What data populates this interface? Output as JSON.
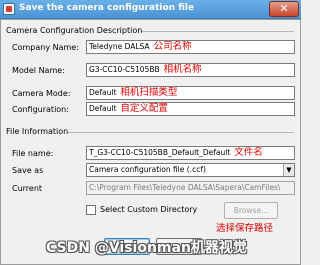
{
  "window": {
    "title": "Save the camera configuration file",
    "close_glyph": "✕"
  },
  "camera_section": {
    "title": "Camera Configuration Description",
    "company_label": "Company Name:",
    "company_value": "Teledyne DALSA",
    "company_note": "公司名称",
    "model_label": "Model Name:",
    "model_value": "G3-CC10-C5105BB",
    "model_note": "相机名称",
    "mode_label": "Camera Mode:",
    "mode_value": "Default",
    "mode_note": "相机扫描类型",
    "config_label": "Configuration:",
    "config_value": "Default",
    "config_note": "自定义配置"
  },
  "file_section": {
    "title": "File Information",
    "filename_label": "File name:",
    "filename_value": "T_G3-CC10-C5105BB_Default_Default",
    "filename_note": "文件名",
    "saveas_label": "Save as",
    "saveas_value": "Camera configuration file (.ccf)",
    "current_label": "Current",
    "current_value": "C:\\Program Files\\Teledyne DALSA\\Sapera\\CamFiles\\",
    "custom_dir_label": "Select Custom Directory",
    "browse_label": "Browse...",
    "browse_note": "选择保存路径"
  },
  "buttons": {
    "ok": "OK",
    "cancel": "Cancel"
  },
  "watermark": "CSDN @Visionman机器视觉",
  "icons": {
    "title": "camera-file-icon",
    "close": "close-icon",
    "dropdown": "chevron-down-icon"
  },
  "colors": {
    "titlebar": "#4c93d6",
    "annotation": "#e00000",
    "close": "#c9442a"
  }
}
